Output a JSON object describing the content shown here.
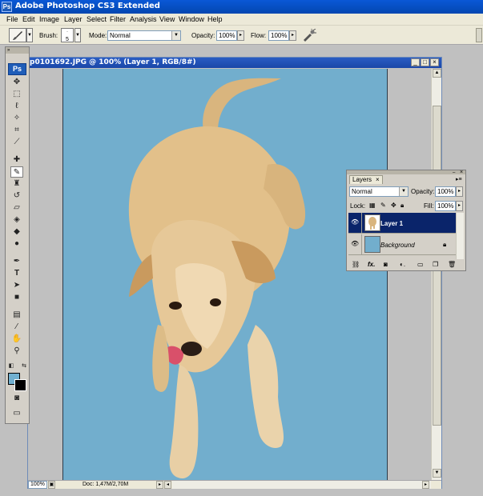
{
  "app": {
    "title": "Adobe Photoshop CS3 Extended",
    "icon": "Ps"
  },
  "menu": [
    "File",
    "Edit",
    "Image",
    "Layer",
    "Select",
    "Filter",
    "Analysis",
    "View",
    "Window",
    "Help"
  ],
  "options": {
    "brush_label": "Brush:",
    "brush_size": "5",
    "mode_label": "Mode:",
    "mode_value": "Normal",
    "opacity_label": "Opacity:",
    "opacity_value": "100%",
    "flow_label": "Flow:",
    "flow_value": "100%"
  },
  "toolbox": {
    "logo": "Ps",
    "tools": [
      "move-tool",
      "marquee-tool",
      "lasso-tool",
      "magic-wand-tool",
      "crop-tool",
      "slice-tool",
      "healing-brush-tool",
      "brush-tool",
      "clone-stamp-tool",
      "history-brush-tool",
      "eraser-tool",
      "paint-bucket-tool",
      "blur-tool",
      "dodge-tool",
      "pen-tool",
      "type-tool",
      "path-selection-tool",
      "rectangle-tool",
      "notes-tool",
      "eyedropper-tool",
      "hand-tool",
      "zoom-tool",
      "quick-mask",
      "screen-mode"
    ],
    "foreground_color": "#71b0d0",
    "background_color": "#000000"
  },
  "document": {
    "title": "p0101692.JPG @ 100% (Layer 1, RGB/8#)",
    "zoom": "100%",
    "doc_info": "Doc: 1,47M/2,70M",
    "canvas_color": "#72aecd"
  },
  "layers_panel": {
    "tab": "Layers",
    "blend_mode": "Normal",
    "opacity_label": "Opacity:",
    "opacity_value": "100%",
    "lock_label": "Lock:",
    "fill_label": "Fill:",
    "fill_value": "100%",
    "layers": [
      {
        "name": "Layer 1",
        "selected": true
      },
      {
        "name": "Background",
        "selected": false,
        "locked": true
      }
    ]
  }
}
